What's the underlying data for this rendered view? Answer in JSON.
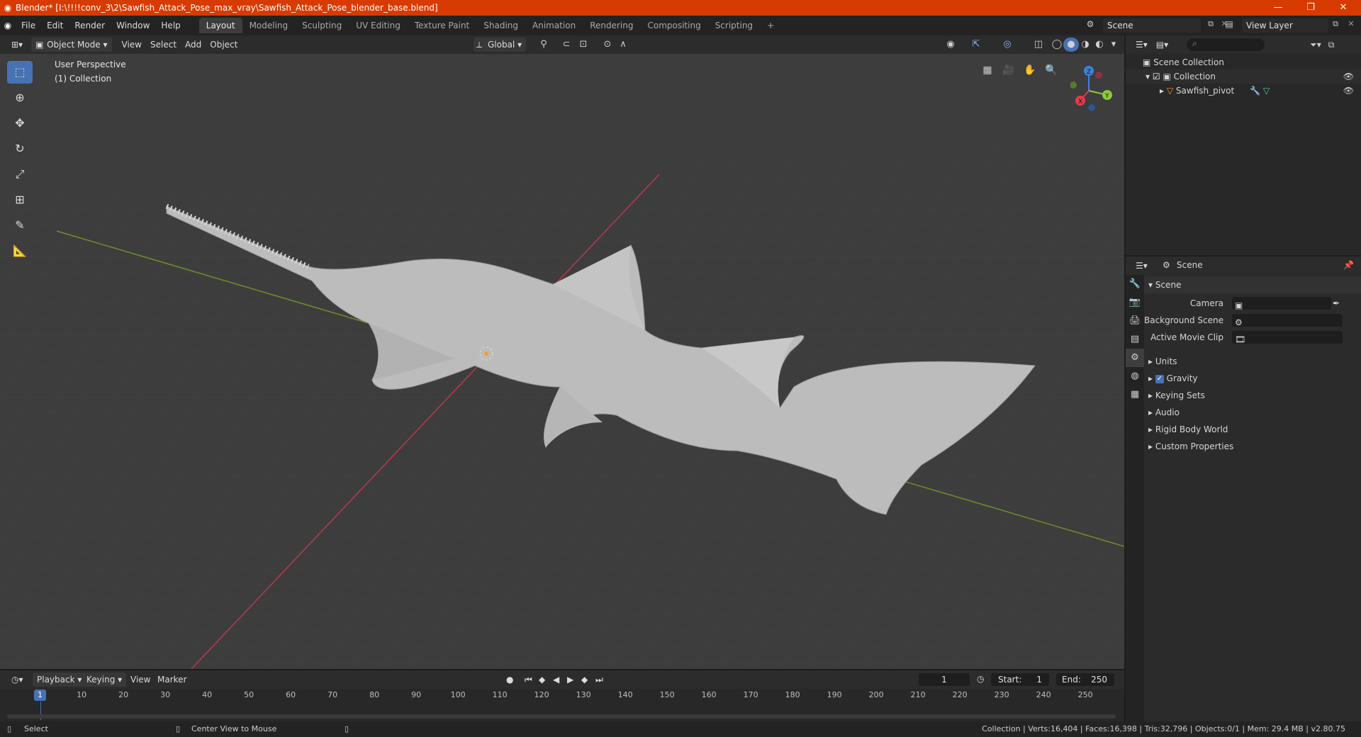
{
  "window": {
    "title": "Blender* [I:\\!!!!conv_3\\2\\Sawfish_Attack_Pose_max_vray\\Sawfish_Attack_Pose_blender_base.blend]",
    "min": "—",
    "max": "❐",
    "close": "✕"
  },
  "menu": [
    "File",
    "Edit",
    "Render",
    "Window",
    "Help"
  ],
  "workspaces": [
    "Layout",
    "Modeling",
    "Sculpting",
    "UV Editing",
    "Texture Paint",
    "Shading",
    "Animation",
    "Rendering",
    "Compositing",
    "Scripting"
  ],
  "active_workspace": "Layout",
  "add_workspace": "+",
  "scene_name": "Scene",
  "view_layer": "View Layer",
  "viewport": {
    "mode": "Object Mode",
    "menus": [
      "View",
      "Select",
      "Add",
      "Object"
    ],
    "transform_orientation": "Global",
    "info_line1": "User Perspective",
    "info_line2": "(1) Collection",
    "gizmo": {
      "x": "X",
      "y": "Y",
      "z": "Z"
    }
  },
  "outliner": {
    "rows": [
      {
        "label": "Scene Collection"
      },
      {
        "label": "Collection"
      },
      {
        "label": "Sawfish_pivot"
      }
    ]
  },
  "properties": {
    "header": "Scene",
    "panel": "Scene",
    "fields": [
      {
        "label": "Camera"
      },
      {
        "label": "Background Scene"
      },
      {
        "label": "Active Movie Clip"
      }
    ],
    "subpanels": [
      "Units",
      "Gravity",
      "Keying Sets",
      "Audio",
      "Rigid Body World",
      "Custom Properties"
    ],
    "gravity_checked": true
  },
  "timeline": {
    "menus": [
      "Playback",
      "Keying",
      "View",
      "Marker"
    ],
    "current_frame": "1",
    "start_label": "Start:",
    "start": "1",
    "end_label": "End:",
    "end": "250",
    "ruler": [
      "1",
      "10",
      "20",
      "30",
      "40",
      "50",
      "60",
      "70",
      "80",
      "90",
      "100",
      "110",
      "120",
      "130",
      "140",
      "150",
      "160",
      "170",
      "180",
      "190",
      "200",
      "210",
      "220",
      "230",
      "240",
      "250"
    ]
  },
  "statusbar": {
    "left": "Select",
    "middle": "Center View to Mouse",
    "right": "Collection | Verts:16,404 | Faces:16,398 | Tris:32,796 | Objects:0/1 | Mem: 29.4 MB | v2.80.75"
  },
  "colors": {
    "titlebar": "#d83b01",
    "accent": "#4772b3",
    "axis_x": "#e23b4e",
    "axis_y": "#8fc93a",
    "axis_z": "#3e82d8"
  }
}
